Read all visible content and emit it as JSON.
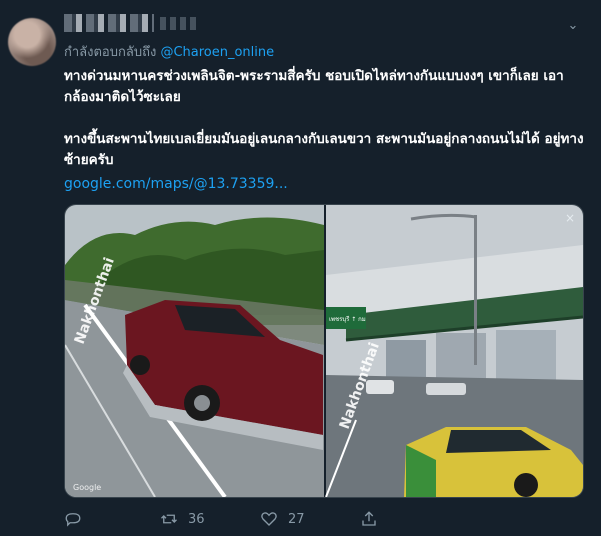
{
  "header": {
    "caret_icon": "chevron-down-icon"
  },
  "reply": {
    "prefix": "กำลังตอบกลับถึง",
    "mention": "@Charoen_online"
  },
  "tweet": {
    "paragraph1": "ทางด่วนมหานครช่วงเพลินจิต-พระรามสี่ครับ ชอบเปิดไหล่ทางกันแบบงงๆ เขาก็เลย เอากล้องมาติดไว้ซะเลย",
    "paragraph2": "ทางขึ้นสะพานไทยเบลเยี่ยมมันอยู่เลนกลางกับเลนขวา สะพานมันอยู่กลางถนนไม่ได้ อยู่ทางซ้ายครับ",
    "link": "google.com/maps/@13.73359..."
  },
  "media": {
    "close_label": "×",
    "watermark": "Google",
    "road_text_left": "Nakhonthai",
    "road_text_right": "Nakhonthai",
    "sign_text": "เพชรบุรี ↑ กม"
  },
  "actions": {
    "reply_icon": "reply-icon",
    "retweet_icon": "retweet-icon",
    "retweet_count": "36",
    "like_icon": "heart-icon",
    "like_count": "27",
    "share_icon": "share-icon"
  },
  "colors": {
    "background": "#15202b",
    "accent": "#1da1f2",
    "muted": "#8899a6"
  }
}
